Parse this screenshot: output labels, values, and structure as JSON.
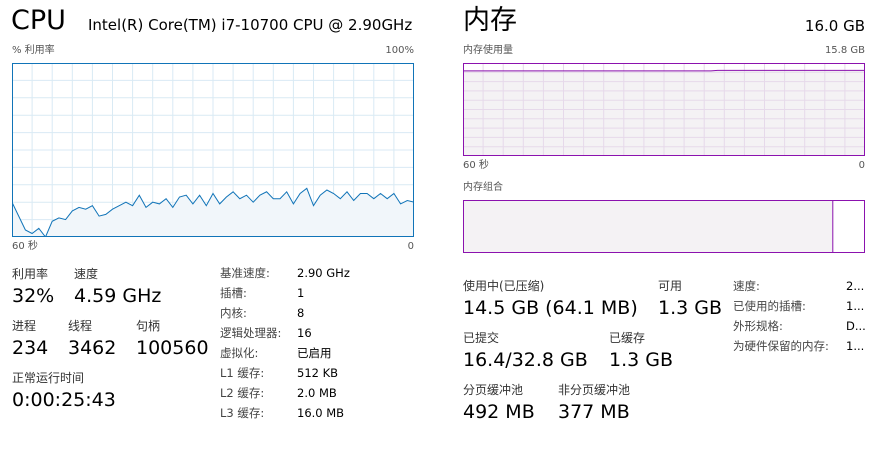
{
  "cpu": {
    "title": "CPU",
    "model": "Intel(R) Core(TM) i7-10700 CPU @ 2.90GHz",
    "graph_label": "% 利用率",
    "graph_max": "100%",
    "time_left": "60 秒",
    "time_right": "0",
    "accent": "#1174b8",
    "fill": "#f1f6fa",
    "usage_history": [
      20,
      12,
      4,
      2,
      5,
      0,
      9,
      11,
      10,
      15,
      17,
      16,
      18,
      12,
      13,
      16,
      18,
      20,
      18,
      24,
      17,
      20,
      19,
      22,
      17,
      23,
      24,
      19,
      24,
      18,
      25,
      19,
      23,
      26,
      22,
      24,
      20,
      24,
      26,
      22,
      22,
      26,
      19,
      25,
      28,
      18,
      24,
      27,
      25,
      22,
      26,
      21,
      25,
      25,
      22,
      25,
      22,
      25,
      19,
      21,
      20
    ],
    "stats": {
      "utilization_label": "利用率",
      "utilization_value": "32%",
      "speed_label": "速度",
      "speed_value": "4.59 GHz",
      "processes_label": "进程",
      "processes_value": "234",
      "threads_label": "线程",
      "threads_value": "3462",
      "handles_label": "句柄",
      "handles_value": "100560",
      "uptime_label": "正常运行时间",
      "uptime_value": "0:00:25:43"
    },
    "details": [
      {
        "label": "基准速度:",
        "value": "2.90 GHz"
      },
      {
        "label": "插槽:",
        "value": "1"
      },
      {
        "label": "内核:",
        "value": "8"
      },
      {
        "label": "逻辑处理器:",
        "value": "16"
      },
      {
        "label": "虚拟化:",
        "value": "已启用"
      },
      {
        "label": "L1 缓存:",
        "value": "512 KB"
      },
      {
        "label": "L2 缓存:",
        "value": "2.0 MB"
      },
      {
        "label": "L3 缓存:",
        "value": "16.0 MB"
      }
    ]
  },
  "memory": {
    "title": "内存",
    "total": "16.0 GB",
    "usage_label": "内存使用量",
    "usage_max": "15.8 GB",
    "time_left": "60 秒",
    "time_right": "0",
    "composition_label": "内存组合",
    "accent": "#8b12ae",
    "fill": "#f4f2f4",
    "usage_history_fraction": [
      0.915,
      0.915,
      0.915,
      0.915,
      0.915,
      0.915,
      0.915,
      0.915,
      0.915,
      0.915,
      0.915,
      0.915,
      0.915,
      0.915,
      0.915,
      0.915,
      0.915,
      0.915,
      0.915,
      0.915,
      0.915,
      0.915,
      0.915,
      0.915,
      0.915,
      0.915,
      0.915,
      0.915,
      0.915,
      0.915,
      0.915,
      0.915,
      0.915,
      0.915,
      0.915,
      0.915,
      0.915,
      0.915,
      0.92,
      0.92,
      0.92,
      0.92,
      0.92,
      0.92,
      0.92,
      0.92,
      0.92,
      0.92,
      0.92,
      0.92,
      0.92,
      0.92,
      0.92,
      0.92,
      0.92,
      0.92,
      0.92,
      0.92,
      0.92,
      0.92,
      0.92
    ],
    "composition_in_use_fraction": 0.92,
    "stats": {
      "in_use_label": "使用中(已压缩)",
      "in_use_value": "14.5 GB (64.1 MB)",
      "available_label": "可用",
      "available_value": "1.3 GB",
      "committed_label": "已提交",
      "committed_value": "16.4/32.8 GB",
      "cached_label": "已缓存",
      "cached_value": "1.3 GB",
      "paged_label": "分页缓冲池",
      "paged_value": "492 MB",
      "nonpaged_label": "非分页缓冲池",
      "nonpaged_value": "377 MB"
    },
    "details": [
      {
        "label": "速度:",
        "value": "2..."
      },
      {
        "label": "已使用的插槽:",
        "value": "1..."
      },
      {
        "label": "外形规格:",
        "value": "D..."
      },
      {
        "label": "为硬件保留的内存:",
        "value": "1..."
      }
    ]
  }
}
